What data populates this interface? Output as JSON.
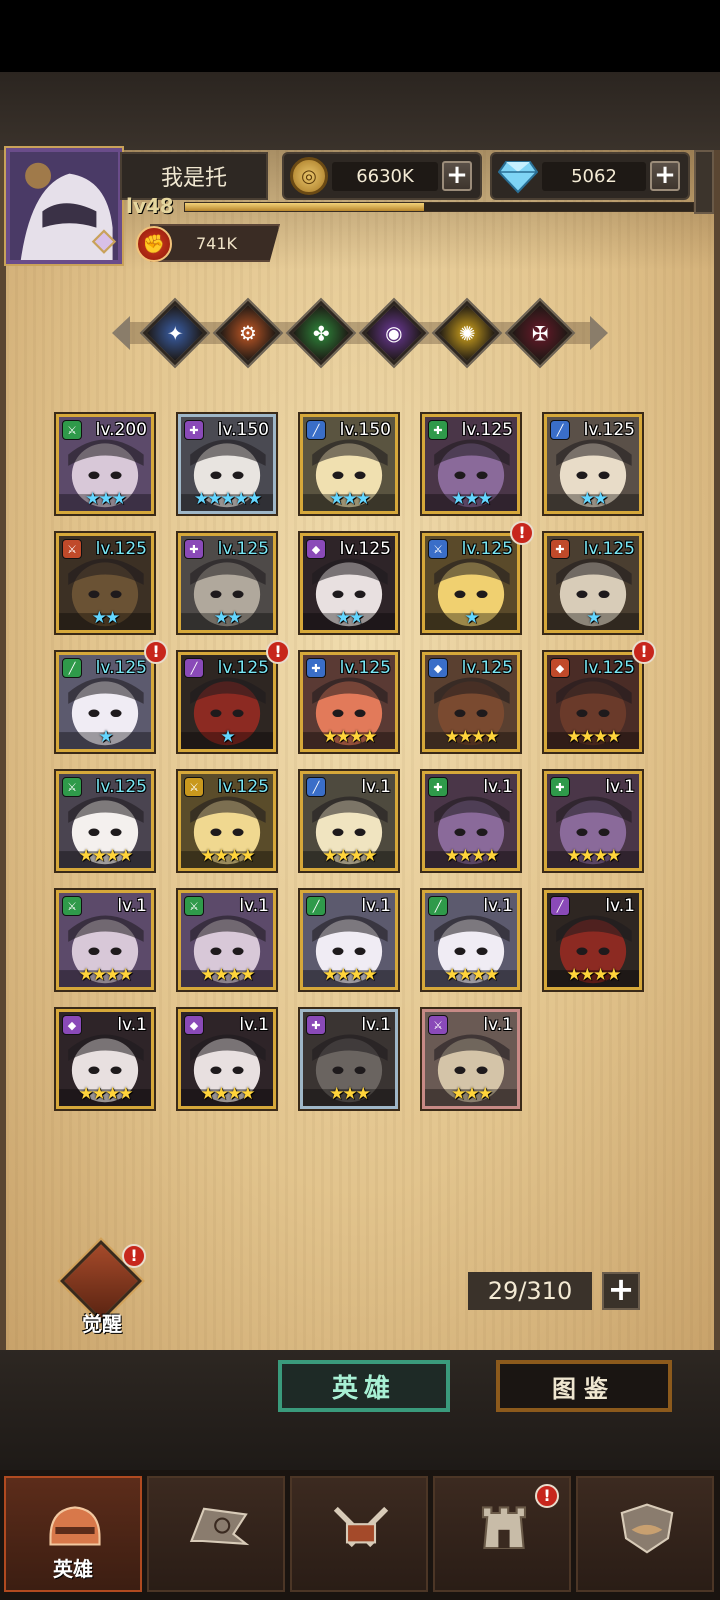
{
  "player": {
    "name": "我是托",
    "level": "lv48",
    "xp_fraction": 0.47,
    "power": "741K"
  },
  "currencies": {
    "gold": "6630K",
    "gems": "5062"
  },
  "filters": [
    {
      "icon": "holy-sword-faction-icon",
      "color": "#3a5fa8"
    },
    {
      "icon": "mechanic-gear-faction-icon",
      "color": "#c55a26"
    },
    {
      "icon": "nature-clover-faction-icon",
      "color": "#2f8a3c"
    },
    {
      "icon": "arcane-eye-faction-icon",
      "color": "#6e3a9c"
    },
    {
      "icon": "sun-faction-icon",
      "color": "#d6a81e"
    },
    {
      "icon": "demon-faction-icon",
      "color": "#6a1a2a"
    }
  ],
  "heroes": [
    {
      "level": "lv.200",
      "stars": "★★★",
      "star_color": "cyan",
      "frame": "gold",
      "faction": "green-sword",
      "alert": false
    },
    {
      "level": "lv.150",
      "stars": "★★★★★",
      "star_color": "cyan",
      "frame": "silver",
      "faction": "purple-cross",
      "alert": false
    },
    {
      "level": "lv.150",
      "stars": "★★★",
      "star_color": "cyan",
      "frame": "gold",
      "faction": "blue-blade",
      "alert": false
    },
    {
      "level": "lv.125",
      "stars": "★★★",
      "star_color": "cyan",
      "frame": "gold",
      "faction": "green-cross",
      "alert": false
    },
    {
      "level": "lv.125",
      "stars": "★★",
      "star_color": "cyan",
      "frame": "gold",
      "faction": "blue-blade",
      "alert": false
    },
    {
      "level": "lv.125",
      "stars": "★★",
      "star_color": "cyan",
      "frame": "gold",
      "faction": "red-sword",
      "alert": false,
      "level_color": "cyan"
    },
    {
      "level": "lv.125",
      "stars": "★★",
      "star_color": "cyan",
      "frame": "gold",
      "faction": "purple-cross",
      "alert": false,
      "level_color": "cyan"
    },
    {
      "level": "lv.125",
      "stars": "★★",
      "star_color": "cyan",
      "frame": "gold",
      "faction": "purple-drop",
      "alert": false
    },
    {
      "level": "lv.125",
      "stars": "★",
      "star_color": "cyan",
      "frame": "gold",
      "faction": "blue-sword",
      "alert": true,
      "level_color": "cyan"
    },
    {
      "level": "lv.125",
      "stars": "★",
      "star_color": "cyan",
      "frame": "gold",
      "faction": "red-cross",
      "alert": false,
      "level_color": "cyan"
    },
    {
      "level": "lv.125",
      "stars": "★",
      "star_color": "cyan",
      "frame": "gold",
      "faction": "green-blade",
      "alert": true,
      "level_color": "cyan"
    },
    {
      "level": "lv.125",
      "stars": "★",
      "star_color": "cyan",
      "frame": "gold",
      "faction": "purple-blade",
      "alert": true,
      "level_color": "cyan"
    },
    {
      "level": "lv.125",
      "stars": "★★★★",
      "star_color": "gold",
      "frame": "gold",
      "faction": "blue-cross",
      "alert": false,
      "level_color": "cyan"
    },
    {
      "level": "lv.125",
      "stars": "★★★★",
      "star_color": "gold",
      "frame": "gold",
      "faction": "blue-drop",
      "alert": false,
      "level_color": "cyan"
    },
    {
      "level": "lv.125",
      "stars": "★★★★",
      "star_color": "gold",
      "frame": "gold",
      "faction": "red-drop",
      "alert": true,
      "level_color": "cyan"
    },
    {
      "level": "lv.125",
      "stars": "★★★★",
      "star_color": "gold",
      "frame": "gold",
      "faction": "green-sword",
      "alert": false,
      "level_color": "cyan"
    },
    {
      "level": "lv.125",
      "stars": "★★★★",
      "star_color": "gold",
      "frame": "gold",
      "faction": "gold-sword",
      "alert": false,
      "level_color": "cyan"
    },
    {
      "level": "lv.1",
      "stars": "★★★★",
      "star_color": "gold",
      "frame": "gold",
      "faction": "blue-blade",
      "alert": false
    },
    {
      "level": "lv.1",
      "stars": "★★★★",
      "star_color": "gold",
      "frame": "gold",
      "faction": "green-cross",
      "alert": false
    },
    {
      "level": "lv.1",
      "stars": "★★★★",
      "star_color": "gold",
      "frame": "gold",
      "faction": "green-cross",
      "alert": false
    },
    {
      "level": "lv.1",
      "stars": "★★★★",
      "star_color": "gold",
      "frame": "gold",
      "faction": "green-sword",
      "alert": false
    },
    {
      "level": "lv.1",
      "stars": "★★★★",
      "star_color": "gold",
      "frame": "gold",
      "faction": "green-sword",
      "alert": false
    },
    {
      "level": "lv.1",
      "stars": "★★★★",
      "star_color": "gold",
      "frame": "gold",
      "faction": "green-blade",
      "alert": false
    },
    {
      "level": "lv.1",
      "stars": "★★★★",
      "star_color": "gold",
      "frame": "gold",
      "faction": "green-blade",
      "alert": false
    },
    {
      "level": "lv.1",
      "stars": "★★★★",
      "star_color": "gold",
      "frame": "gold",
      "faction": "purple-blade",
      "alert": false
    },
    {
      "level": "lv.1",
      "stars": "★★★★",
      "star_color": "gold",
      "frame": "gold",
      "faction": "purple-drop",
      "alert": false
    },
    {
      "level": "lv.1",
      "stars": "★★★★",
      "star_color": "gold",
      "frame": "gold",
      "faction": "purple-drop",
      "alert": false
    },
    {
      "level": "lv.1",
      "stars": "★★★",
      "star_color": "gold",
      "frame": "silver",
      "faction": "purple-cross",
      "alert": false
    },
    {
      "level": "lv.1",
      "stars": "★★★",
      "star_color": "gold",
      "frame": "pink",
      "faction": "purple-sword",
      "alert": false
    }
  ],
  "awaken": {
    "label": "觉醒"
  },
  "hero_count": "29/310",
  "tabs": {
    "hero": "英雄",
    "guide": "图鉴"
  },
  "nav": [
    {
      "icon": "helmet-icon",
      "label": "英雄",
      "active": true
    },
    {
      "icon": "flag-icon",
      "label": "",
      "active": false
    },
    {
      "icon": "crossed-swords-icon",
      "label": "",
      "active": false
    },
    {
      "icon": "castle-tower-icon",
      "label": "",
      "active": false,
      "alert": true
    },
    {
      "icon": "handshake-shield-icon",
      "label": "",
      "active": false
    }
  ]
}
